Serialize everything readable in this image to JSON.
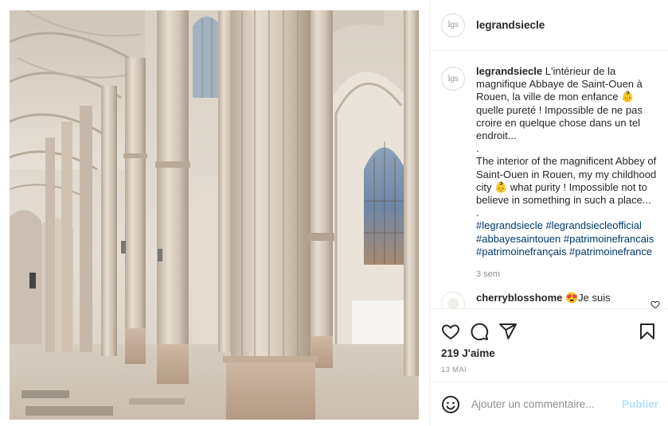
{
  "header": {
    "avatar_monogram": "lgs",
    "username": "legrandsiecle"
  },
  "photo": {
    "description_icon": "cathedral-interior-photo"
  },
  "caption": {
    "username": "legrandsiecle",
    "text_fr": "L'intérieur de la magnifique Abbaye de Saint-Ouen à Rouen, la ville de mon enfance 👶 quelle pureté ! Impossible de ne pas croire en quelque chose dans un tel endroit...",
    "dot1": ".",
    "text_en": "The interior of the magnificent Abbey of Saint-Ouen in Rouen, my my childhood city 👶 what purity ! Impossible not to believe in something in such a place...",
    "dot2": ".",
    "hashtags": "#legrandsiecle #legrandsiecleofficial #abbayesaintouen #patrimoinefrancais #patrimoinefrançais #patrimoinefrance",
    "time_ago": "3 sem"
  },
  "comment": {
    "username": "cherryblosshome",
    "text": "😍Je suis"
  },
  "actions": {
    "like_icon": "heart-icon",
    "comment_icon": "comment-bubble-icon",
    "share_icon": "paper-plane-icon",
    "save_icon": "bookmark-icon",
    "likes": "219 J'aime",
    "date": "13 MAI"
  },
  "add_comment": {
    "emoji_icon": "smiley-icon",
    "placeholder": "Ajouter un commentaire...",
    "post_label": "Publier"
  },
  "colors": {
    "link": "#00376b",
    "post_button_disabled": "#b2dffc",
    "secondary_text": "#8e8e8e"
  }
}
